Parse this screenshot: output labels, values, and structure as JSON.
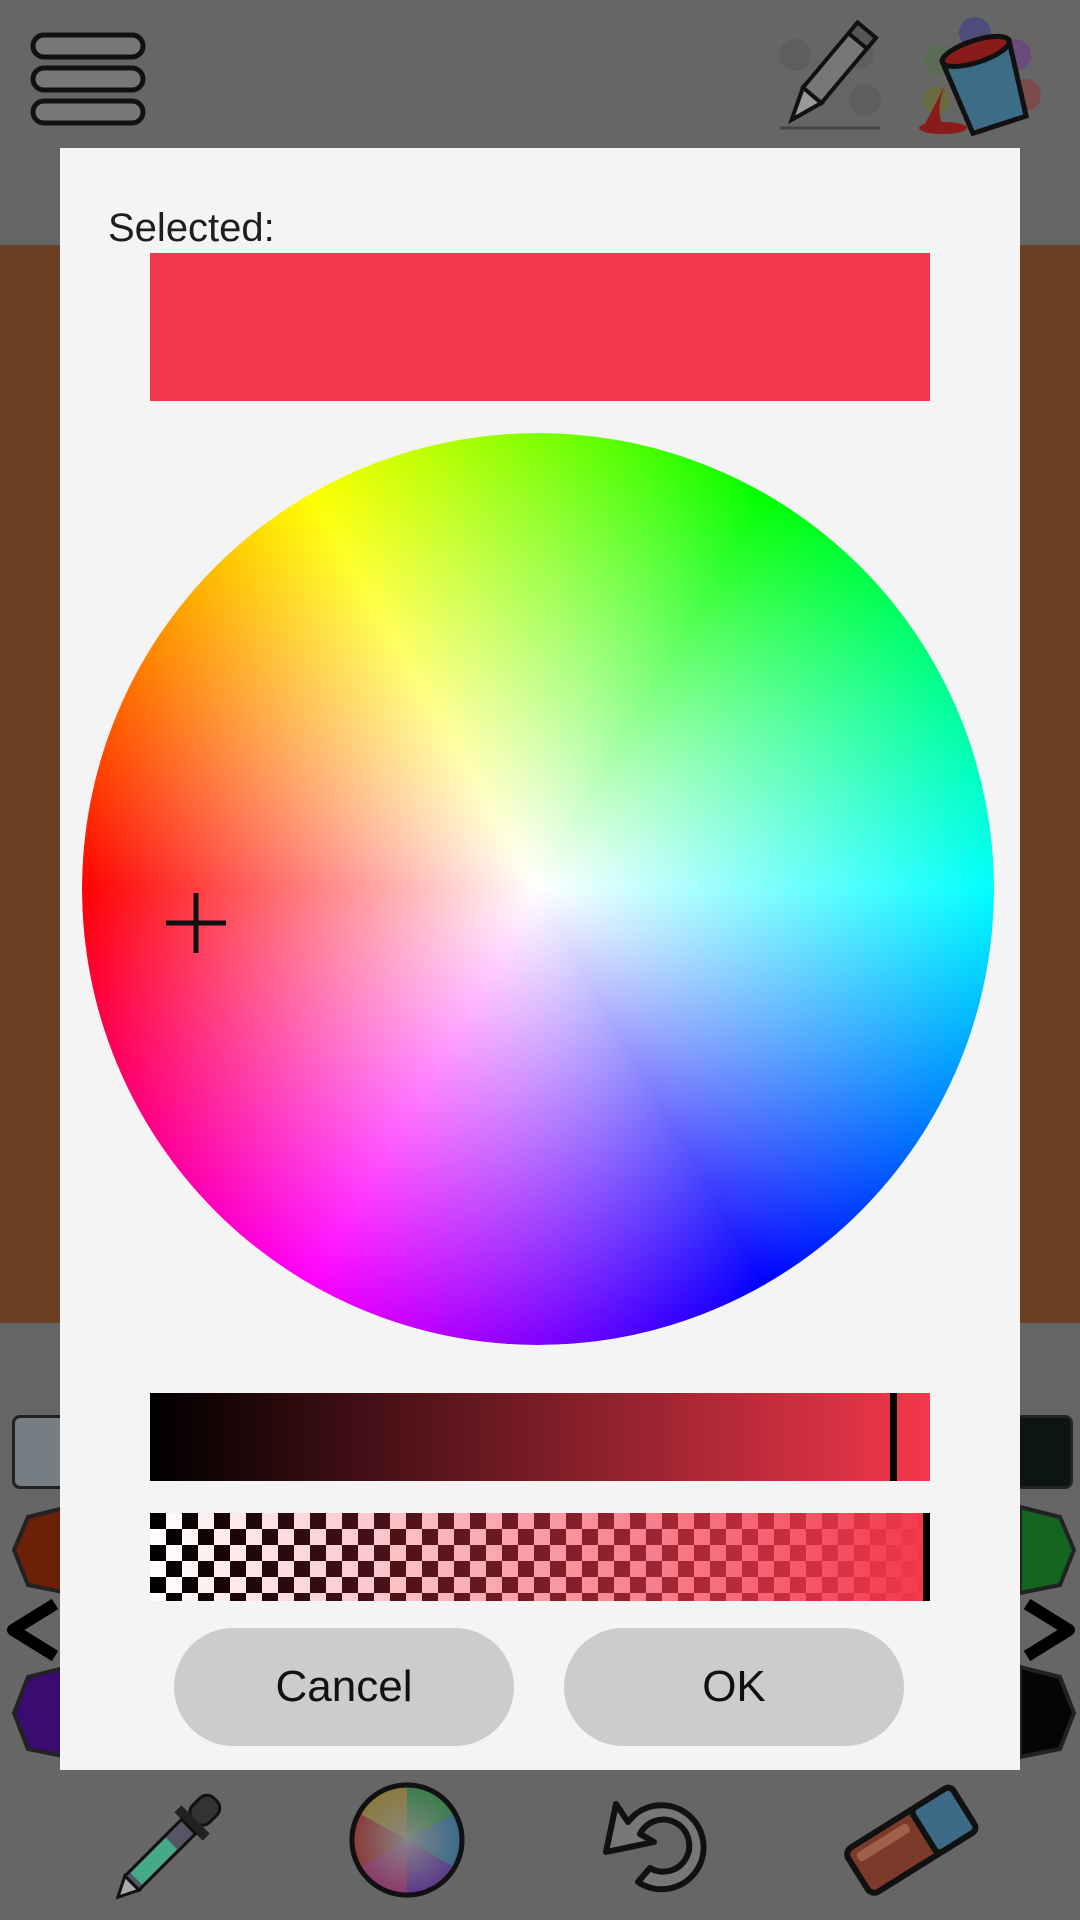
{
  "app": {
    "icons": {
      "menu": "hamburger-menu-icon",
      "pencil": "pencil-tool-icon",
      "paint_bucket": "paint-bucket-icon",
      "eyedropper": "eyedropper-icon",
      "color_wheel": "color-wheel-icon",
      "undo": "undo-icon",
      "eraser": "eraser-icon"
    },
    "canvas_color": "#6a4023"
  },
  "dialog": {
    "selected_label": "Selected:",
    "selected_color": "#f4384c",
    "brightness_level": 0.97,
    "alpha_level": 1.0,
    "cancel_label": "Cancel",
    "ok_label": "OK"
  }
}
